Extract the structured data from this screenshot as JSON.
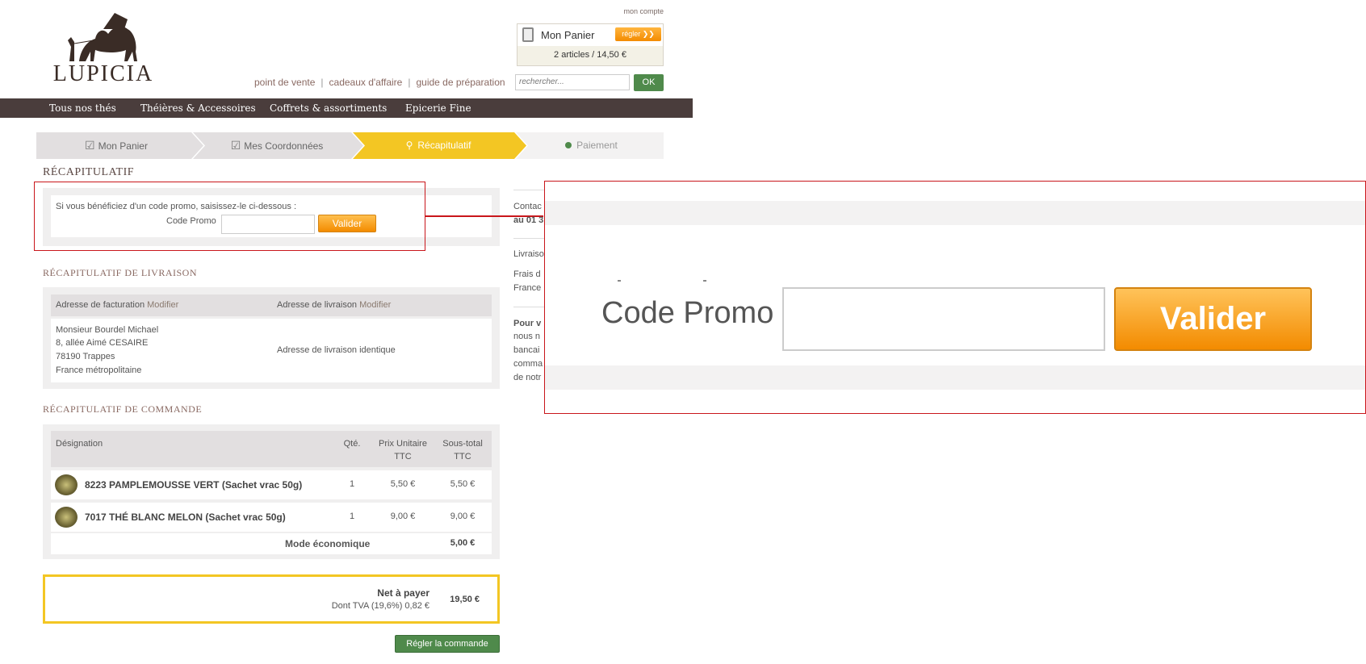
{
  "header": {
    "logo_text": "LUPICIA",
    "account_link": "mon compte",
    "cart": {
      "title": "Mon Panier",
      "button": "régler ❯❯",
      "summary": "2  articles / 14,50 €"
    },
    "links": [
      "point de vente",
      "cadeaux d'affaire",
      "guide de préparation"
    ],
    "search_placeholder": "rechercher...",
    "search_button": "OK"
  },
  "nav": [
    "Tous nos thés",
    "Théières & Accessoires",
    "Coffrets & assortiments",
    "Epicerie Fine"
  ],
  "steps": [
    "Mon Panier",
    "Mes Coordonnées",
    "Récapitulatif",
    "Paiement"
  ],
  "page_title": "RÉCAPITULATIF",
  "promo": {
    "hint": "Si vous bénéficiez d'un code promo, saisissez-le ci-dessous :",
    "label": "Code Promo",
    "button": "Valider"
  },
  "delivery": {
    "title": "RÉCAPITULATIF DE LIVRAISON",
    "billing_label": "Adresse de facturation",
    "shipping_label": "Adresse de livraison",
    "modify": "Modifier",
    "billing_lines": [
      "Monsieur Bourdel Michael",
      "8, allée Aimé CESAIRE",
      "78190 Trappes",
      "France métropolitaine"
    ],
    "shipping_text": "Adresse de livraison identique"
  },
  "order": {
    "title": "RÉCAPITULATIF DE COMMANDE",
    "headers": {
      "designation": "Désignation",
      "qty": "Qté.",
      "unit_1": "Prix Unitaire",
      "unit_2": "TTC",
      "sub_1": "Sous-total",
      "sub_2": "TTC"
    },
    "rows": [
      {
        "name": "8223 PAMPLEMOUSSE VERT (Sachet vrac 50g)",
        "qty": "1",
        "unit": "5,50 €",
        "sub": "5,50 €"
      },
      {
        "name": "7017 THÉ BLANC MELON (Sachet vrac 50g)",
        "qty": "1",
        "unit": "9,00 €",
        "sub": "9,00 €"
      }
    ],
    "shipping_label": "Mode économique",
    "shipping_value": "5,00 €"
  },
  "total": {
    "label": "Net à payer",
    "tva": "Dont TVA (19,6%) 0,82 €",
    "value": "19,50 €"
  },
  "order_button": "Régler la commande",
  "sidebar": {
    "contact_1": "Contac",
    "contact_2": "au 01 3",
    "livraison": "Livraiso",
    "frais": "Frais d",
    "france": "France",
    "pour": "Pour v",
    "lines": [
      "nous n",
      "bancai",
      "comma",
      "de notr"
    ]
  },
  "zoom": {
    "label": "Code Promo",
    "button": "Valider"
  },
  "colors": {
    "nav_bg": "#4a3d3c",
    "step_active": "#f3c623",
    "accent_orange": "#f38b00",
    "accent_green": "#4f8a4b",
    "highlight_red": "#c9161b"
  }
}
